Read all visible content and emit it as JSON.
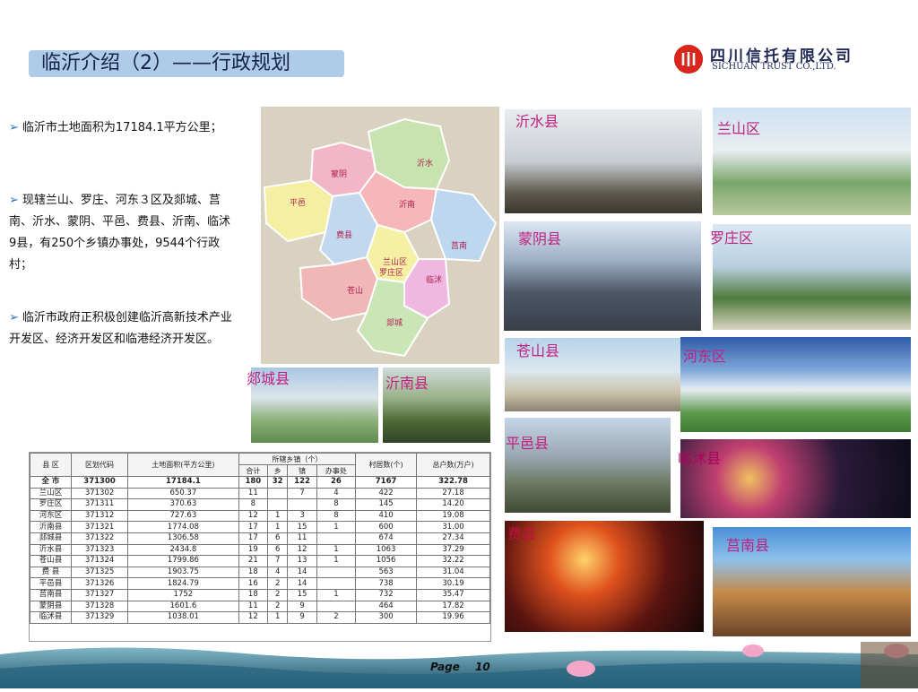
{
  "title": "临沂介绍（2）——行政规划",
  "logo": {
    "cn": "四川信托有限公司",
    "en": "SICHUAN TRUST CO.,LTD."
  },
  "bullets": [
    "临沂市土地面积为17184.1平方公里；",
    "现辖兰山、罗庄、河东３区及郯城、莒南、沂水、蒙阴、平邑、费县、沂南、临沭9县，有250个乡镇办事处，9544个行政村；",
    "临沂市政府正积极创建临沂高新技术产业开发区、经济开发区和临港经济开发区。"
  ],
  "map_labels": [
    "沂水",
    "蒙阴",
    "沂南",
    "平邑",
    "费县",
    "莒南",
    "兰山区",
    "罗庄区",
    "临沭",
    "苍山",
    "郯城"
  ],
  "photo_labels": {
    "yishui": "沂水县",
    "lanshan": "兰山区",
    "mengyin": "蒙阴县",
    "luozhuang": "罗庄区",
    "cangshan": "苍山县",
    "hedong": "河东区",
    "tancheng": "郯城县",
    "yinan": "沂南县",
    "pingyi": "平邑县",
    "junan": "莒南县",
    "linshu": "临沭县",
    "feixian": "费县"
  },
  "table": {
    "headers": {
      "county": "县 区",
      "code": "区划代码",
      "area": "土地面积(平方公里)",
      "towns": "所辖乡镇（个）",
      "total": "合计",
      "xiang": "乡",
      "zhen": "镇",
      "office": "办事处",
      "villages": "村居数(个)",
      "households": "总户数(万户)"
    },
    "rows": [
      [
        "全 市",
        "371300",
        "17184.1",
        "180",
        "32",
        "122",
        "26",
        "7167",
        "322.78"
      ],
      [
        "兰山区",
        "371302",
        "650.37",
        "11",
        "",
        "7",
        "4",
        "422",
        "27.18"
      ],
      [
        "罗庄区",
        "371311",
        "370.63",
        "8",
        "",
        "",
        "8",
        "145",
        "14.20"
      ],
      [
        "河东区",
        "371312",
        "727.63",
        "12",
        "1",
        "3",
        "8",
        "410",
        "19.08"
      ],
      [
        "沂南县",
        "371321",
        "1774.08",
        "17",
        "1",
        "15",
        "1",
        "600",
        "31.00"
      ],
      [
        "郯城县",
        "371322",
        "1306.58",
        "17",
        "6",
        "11",
        "",
        "674",
        "27.34"
      ],
      [
        "沂水县",
        "371323",
        "2434.8",
        "19",
        "6",
        "12",
        "1",
        "1063",
        "37.29"
      ],
      [
        "苍山县",
        "371324",
        "1799.86",
        "21",
        "7",
        "13",
        "1",
        "1056",
        "32.22"
      ],
      [
        "费 县",
        "371325",
        "1903.75",
        "18",
        "4",
        "14",
        "",
        "563",
        "31.04"
      ],
      [
        "平邑县",
        "371326",
        "1824.79",
        "16",
        "2",
        "14",
        "",
        "738",
        "30.19"
      ],
      [
        "莒南县",
        "371327",
        "1752",
        "18",
        "2",
        "15",
        "1",
        "732",
        "35.47"
      ],
      [
        "蒙阴县",
        "371328",
        "1601.6",
        "11",
        "2",
        "9",
        "",
        "464",
        "17.82"
      ],
      [
        "临沭县",
        "371329",
        "1038.01",
        "12",
        "1",
        "9",
        "2",
        "300",
        "19.96"
      ]
    ]
  },
  "footer": {
    "page_label": "Page",
    "page_number": "10"
  }
}
